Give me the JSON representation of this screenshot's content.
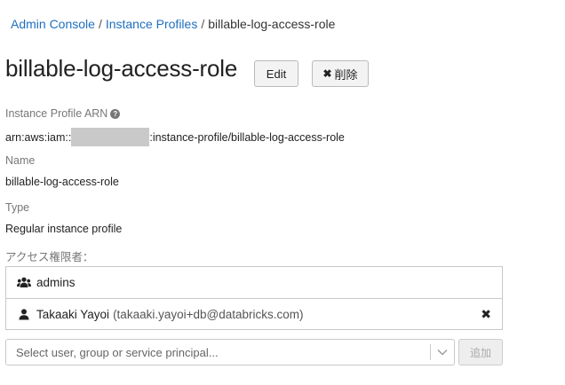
{
  "breadcrumb": {
    "items": [
      "Admin Console",
      "Instance Profiles"
    ],
    "separator": "/",
    "current": "billable-log-access-role"
  },
  "header": {
    "title": "billable-log-access-role",
    "edit_label": "Edit",
    "delete_label": "削除"
  },
  "fields": {
    "arn_label": "Instance Profile ARN",
    "arn_prefix": "arn:aws:iam::",
    "arn_suffix": ":instance-profile/billable-log-access-role",
    "name_label": "Name",
    "name_value": "billable-log-access-role",
    "type_label": "Type",
    "type_value": "Regular instance profile",
    "access_label": "アクセス権限者："
  },
  "acl": [
    {
      "icon": "group-icon",
      "name": "admins",
      "email": "",
      "removable": false
    },
    {
      "icon": "user-icon",
      "name": "Takaaki Yayoi",
      "email": "(takaaki.yayoi+db@databricks.com)",
      "removable": true
    }
  ],
  "add_principal": {
    "placeholder": "Select user, group or service principal...",
    "add_label": "追加"
  },
  "colors": {
    "link": "#1f6fbf",
    "border": "#c8c8c8",
    "muted": "#777777"
  }
}
